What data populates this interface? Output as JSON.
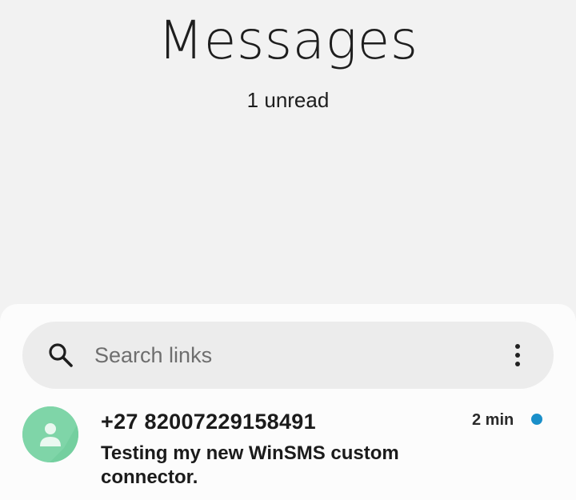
{
  "header": {
    "title": "Messages",
    "unread_label": "1 unread"
  },
  "search": {
    "placeholder": "Search links",
    "value": ""
  },
  "icons": {
    "search": "search-icon",
    "more": "more-vertical-icon",
    "avatar": "person-icon"
  },
  "conversations": [
    {
      "sender": "+27 82007229158491",
      "time": "2 min",
      "preview": "Testing my new WinSMS custom connector.",
      "unread": true
    }
  ],
  "colors": {
    "background": "#f2f2f2",
    "panel": "#fcfcfc",
    "search_bar": "#ececec",
    "avatar": "#7fd5a8",
    "unread_dot": "#1a8fc9"
  }
}
